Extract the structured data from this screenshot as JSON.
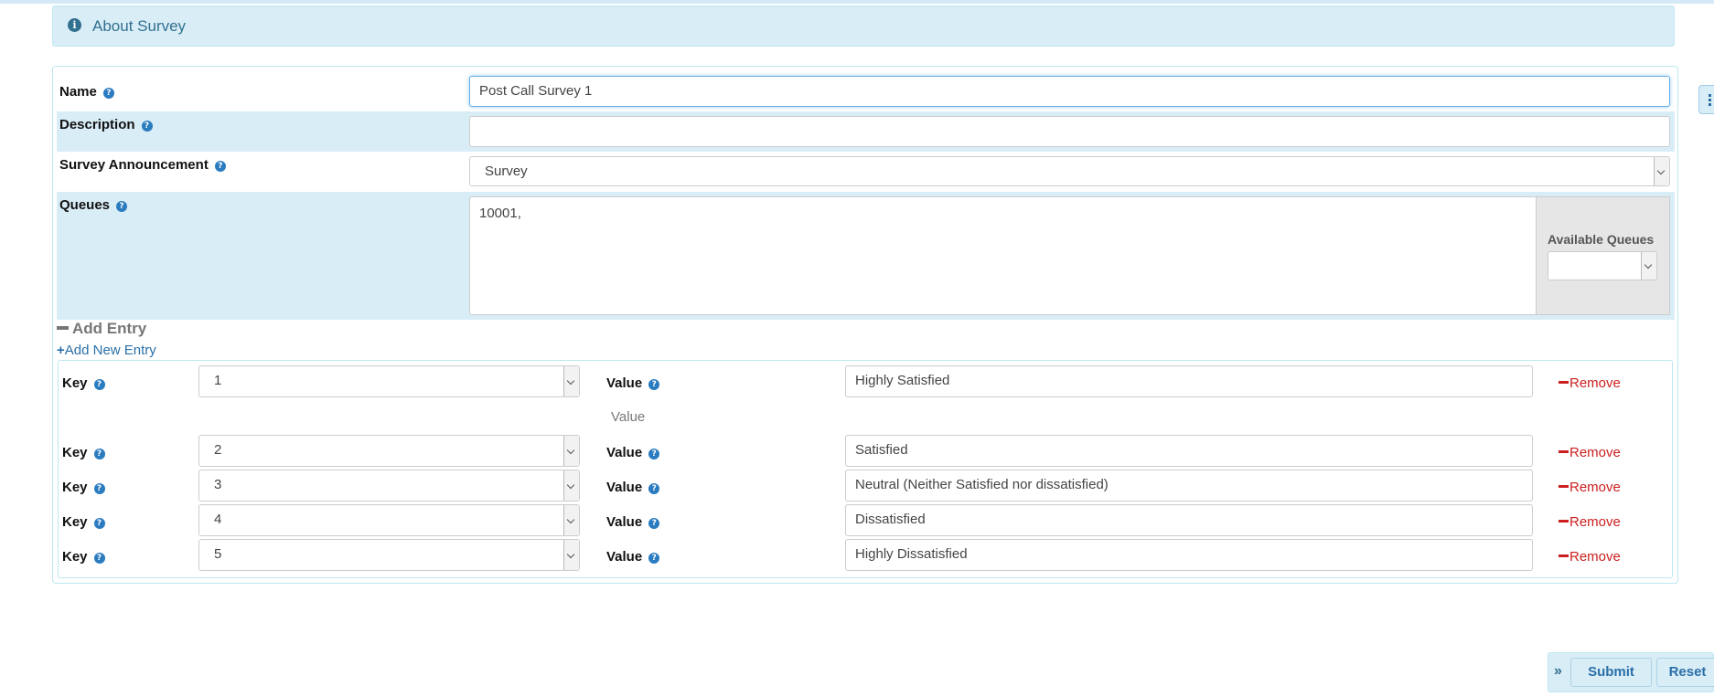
{
  "about": {
    "title": "About Survey"
  },
  "form": {
    "name": {
      "label": "Name",
      "value": "Post Call Survey 1"
    },
    "description": {
      "label": "Description",
      "value": ""
    },
    "announcement": {
      "label": "Survey Announcement",
      "value": "Survey"
    },
    "queues": {
      "label": "Queues",
      "value": "10001,",
      "available_label": "Available Queues",
      "available_value": ""
    }
  },
  "entries_section": {
    "title": "Add Entry",
    "add_new": "Add New Entry",
    "key_label": "Key",
    "value_label": "Value",
    "remove_label": "Remove",
    "value_hint": "Value",
    "rows": [
      {
        "key": "1",
        "value": "Highly Satisfied"
      },
      {
        "key": "2",
        "value": "Satisfied"
      },
      {
        "key": "3",
        "value": "Neutral (Neither Satisfied nor dissatisfied)"
      },
      {
        "key": "4",
        "value": "Dissatisfied"
      },
      {
        "key": "5",
        "value": "Highly Dissatisfied"
      }
    ]
  },
  "actions": {
    "submit": "Submit",
    "reset": "Reset",
    "collapse_icon": "double-chevron-right-icon"
  },
  "colors": {
    "accent": "#31708f",
    "info_bg": "#d9edf7",
    "remove": "#cc1f1f"
  }
}
